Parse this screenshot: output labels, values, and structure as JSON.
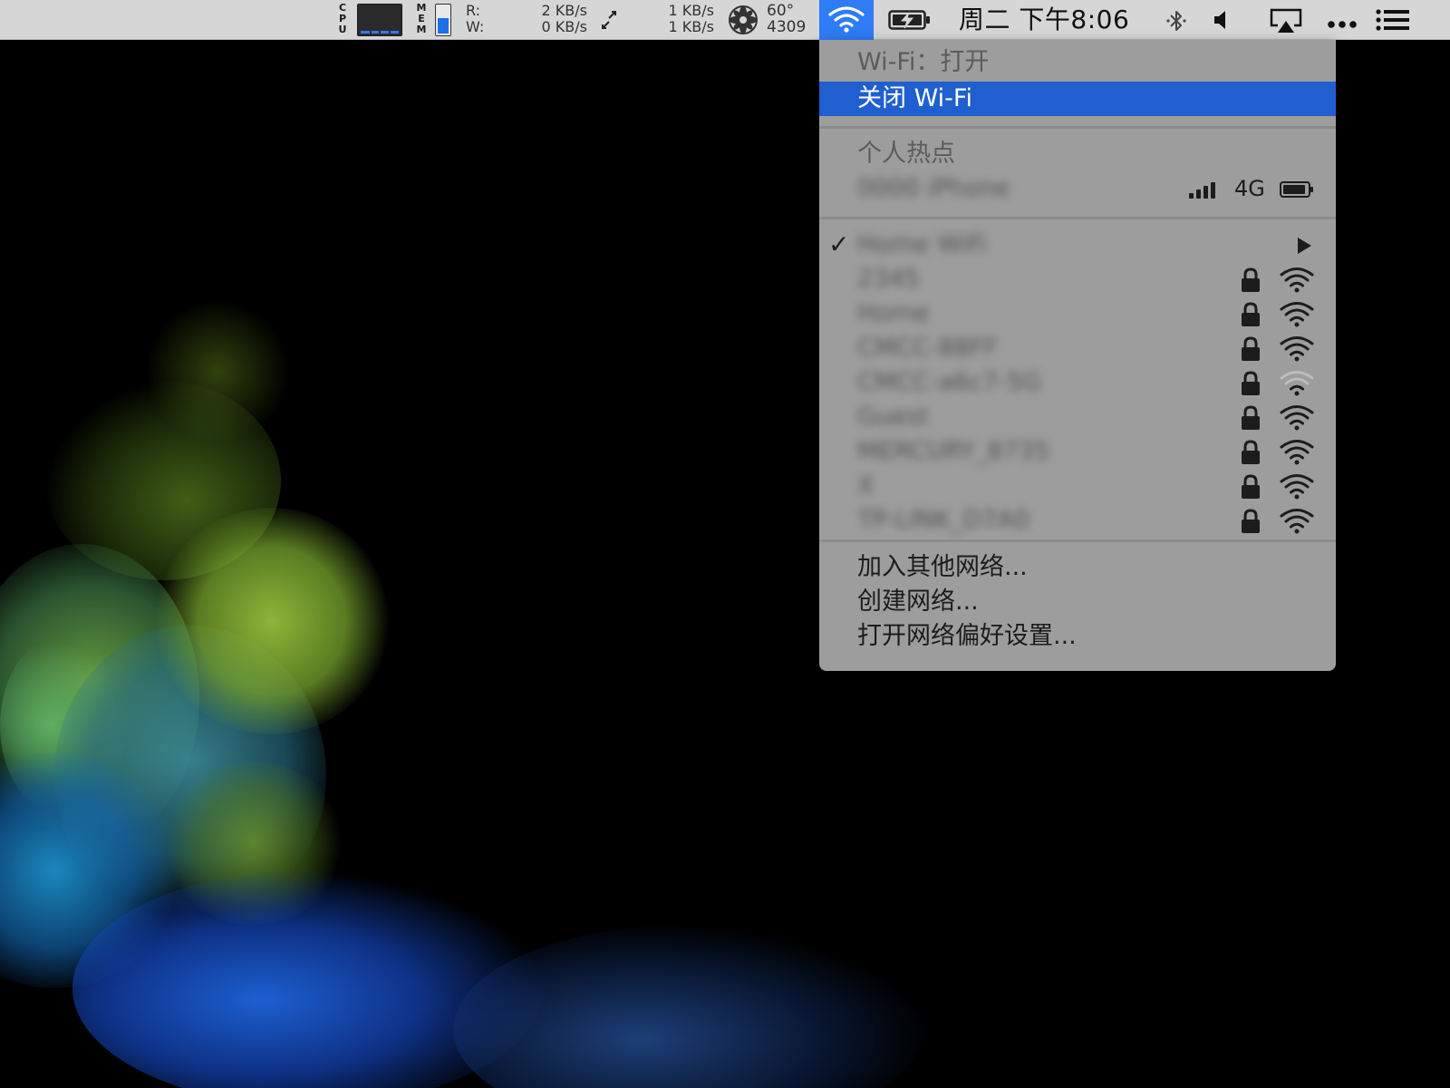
{
  "menubar": {
    "cpu_label": "CPU",
    "mem_label": "MEM",
    "disk_read_label": "R:",
    "disk_write_label": "W:",
    "disk_read_value": "2 KB/s",
    "disk_write_value": "0 KB/s",
    "net_up_value": "1 KB/s",
    "net_down_value": "1 KB/s",
    "temperature": "60°",
    "fan_rpm": "4309",
    "clock": "周二 下午8:06",
    "memory_usage_fraction": 0.55,
    "accent_color": "#2e7cf6"
  },
  "wifi_menu": {
    "status": "Wi-Fi：打开",
    "toggle": "关闭 Wi-Fi",
    "hotspot_header": "个人热点",
    "hotspot_device": "0000 iPhone",
    "hotspot_network": "4G",
    "current_network": "Home WiFi",
    "networks": [
      {
        "name": "2345",
        "locked": true,
        "strength": 4
      },
      {
        "name": "Home",
        "locked": true,
        "strength": 4
      },
      {
        "name": "CMCC-88FF",
        "locked": true,
        "strength": 4
      },
      {
        "name": "CMCC-a6c7-5G",
        "locked": true,
        "strength": 2
      },
      {
        "name": "Guest",
        "locked": true,
        "strength": 4
      },
      {
        "name": "MERCURY_8735",
        "locked": true,
        "strength": 4
      },
      {
        "name": "X",
        "locked": true,
        "strength": 4
      },
      {
        "name": "TP-LINK_D7A0",
        "locked": true,
        "strength": 4
      }
    ],
    "join_other": "加入其他网络...",
    "create_network": "创建网络...",
    "open_prefs": "打开网络偏好设置...",
    "highlight_color": "#1f5fcf"
  }
}
